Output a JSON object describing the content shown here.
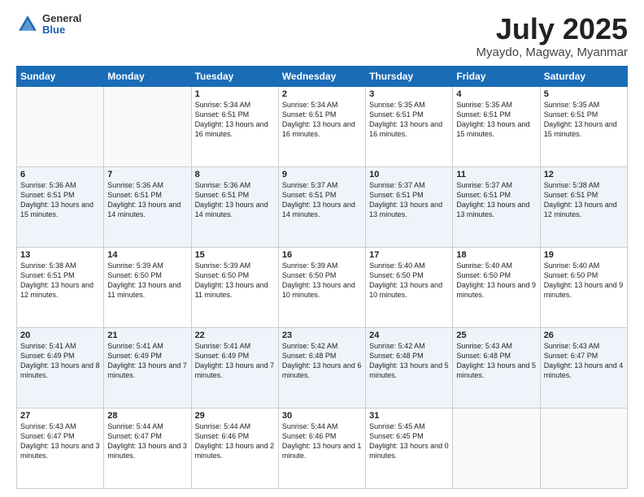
{
  "header": {
    "logo": {
      "general": "General",
      "blue": "Blue"
    },
    "title": "July 2025",
    "location": "Myaydo, Magway, Myanmar"
  },
  "days_of_week": [
    "Sunday",
    "Monday",
    "Tuesday",
    "Wednesday",
    "Thursday",
    "Friday",
    "Saturday"
  ],
  "weeks": [
    [
      {
        "day": "",
        "info": ""
      },
      {
        "day": "",
        "info": ""
      },
      {
        "day": "1",
        "info": "Sunrise: 5:34 AM\nSunset: 6:51 PM\nDaylight: 13 hours and 16 minutes."
      },
      {
        "day": "2",
        "info": "Sunrise: 5:34 AM\nSunset: 6:51 PM\nDaylight: 13 hours and 16 minutes."
      },
      {
        "day": "3",
        "info": "Sunrise: 5:35 AM\nSunset: 6:51 PM\nDaylight: 13 hours and 16 minutes."
      },
      {
        "day": "4",
        "info": "Sunrise: 5:35 AM\nSunset: 6:51 PM\nDaylight: 13 hours and 15 minutes."
      },
      {
        "day": "5",
        "info": "Sunrise: 5:35 AM\nSunset: 6:51 PM\nDaylight: 13 hours and 15 minutes."
      }
    ],
    [
      {
        "day": "6",
        "info": "Sunrise: 5:36 AM\nSunset: 6:51 PM\nDaylight: 13 hours and 15 minutes."
      },
      {
        "day": "7",
        "info": "Sunrise: 5:36 AM\nSunset: 6:51 PM\nDaylight: 13 hours and 14 minutes."
      },
      {
        "day": "8",
        "info": "Sunrise: 5:36 AM\nSunset: 6:51 PM\nDaylight: 13 hours and 14 minutes."
      },
      {
        "day": "9",
        "info": "Sunrise: 5:37 AM\nSunset: 6:51 PM\nDaylight: 13 hours and 14 minutes."
      },
      {
        "day": "10",
        "info": "Sunrise: 5:37 AM\nSunset: 6:51 PM\nDaylight: 13 hours and 13 minutes."
      },
      {
        "day": "11",
        "info": "Sunrise: 5:37 AM\nSunset: 6:51 PM\nDaylight: 13 hours and 13 minutes."
      },
      {
        "day": "12",
        "info": "Sunrise: 5:38 AM\nSunset: 6:51 PM\nDaylight: 13 hours and 12 minutes."
      }
    ],
    [
      {
        "day": "13",
        "info": "Sunrise: 5:38 AM\nSunset: 6:51 PM\nDaylight: 13 hours and 12 minutes."
      },
      {
        "day": "14",
        "info": "Sunrise: 5:39 AM\nSunset: 6:50 PM\nDaylight: 13 hours and 11 minutes."
      },
      {
        "day": "15",
        "info": "Sunrise: 5:39 AM\nSunset: 6:50 PM\nDaylight: 13 hours and 11 minutes."
      },
      {
        "day": "16",
        "info": "Sunrise: 5:39 AM\nSunset: 6:50 PM\nDaylight: 13 hours and 10 minutes."
      },
      {
        "day": "17",
        "info": "Sunrise: 5:40 AM\nSunset: 6:50 PM\nDaylight: 13 hours and 10 minutes."
      },
      {
        "day": "18",
        "info": "Sunrise: 5:40 AM\nSunset: 6:50 PM\nDaylight: 13 hours and 9 minutes."
      },
      {
        "day": "19",
        "info": "Sunrise: 5:40 AM\nSunset: 6:50 PM\nDaylight: 13 hours and 9 minutes."
      }
    ],
    [
      {
        "day": "20",
        "info": "Sunrise: 5:41 AM\nSunset: 6:49 PM\nDaylight: 13 hours and 8 minutes."
      },
      {
        "day": "21",
        "info": "Sunrise: 5:41 AM\nSunset: 6:49 PM\nDaylight: 13 hours and 7 minutes."
      },
      {
        "day": "22",
        "info": "Sunrise: 5:41 AM\nSunset: 6:49 PM\nDaylight: 13 hours and 7 minutes."
      },
      {
        "day": "23",
        "info": "Sunrise: 5:42 AM\nSunset: 6:48 PM\nDaylight: 13 hours and 6 minutes."
      },
      {
        "day": "24",
        "info": "Sunrise: 5:42 AM\nSunset: 6:48 PM\nDaylight: 13 hours and 5 minutes."
      },
      {
        "day": "25",
        "info": "Sunrise: 5:43 AM\nSunset: 6:48 PM\nDaylight: 13 hours and 5 minutes."
      },
      {
        "day": "26",
        "info": "Sunrise: 5:43 AM\nSunset: 6:47 PM\nDaylight: 13 hours and 4 minutes."
      }
    ],
    [
      {
        "day": "27",
        "info": "Sunrise: 5:43 AM\nSunset: 6:47 PM\nDaylight: 13 hours and 3 minutes."
      },
      {
        "day": "28",
        "info": "Sunrise: 5:44 AM\nSunset: 6:47 PM\nDaylight: 13 hours and 3 minutes."
      },
      {
        "day": "29",
        "info": "Sunrise: 5:44 AM\nSunset: 6:46 PM\nDaylight: 13 hours and 2 minutes."
      },
      {
        "day": "30",
        "info": "Sunrise: 5:44 AM\nSunset: 6:46 PM\nDaylight: 13 hours and 1 minute."
      },
      {
        "day": "31",
        "info": "Sunrise: 5:45 AM\nSunset: 6:45 PM\nDaylight: 13 hours and 0 minutes."
      },
      {
        "day": "",
        "info": ""
      },
      {
        "day": "",
        "info": ""
      }
    ]
  ]
}
